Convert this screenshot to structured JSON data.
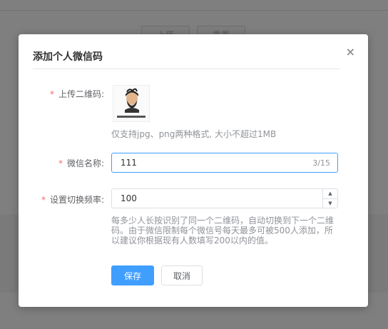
{
  "background": {
    "button_left_label": "上传",
    "button_right_label": "重置"
  },
  "dialog": {
    "title": "添加个人微信码",
    "close_icon": "×",
    "form": {
      "upload": {
        "label": "上传二维码:",
        "required_mark": "*",
        "thumbnail_icon": "avatar-qr-thumbnail",
        "hint": "仅支持jpg、png两种格式, 大小不超过1MB"
      },
      "name": {
        "label": "微信名称:",
        "required_mark": "*",
        "value": "111",
        "counter": "3/15"
      },
      "switch_frequency": {
        "label": "设置切换频率:",
        "required_mark": "*",
        "value": "100",
        "description": "每多少人长按识别了同一个二维码，自动切换到下一个二维码。由于微信限制每个微信号每天最多可被500人添加，所以建议你根据现有人数填写200以内的值。"
      }
    },
    "buttons": {
      "save": "保存",
      "cancel": "取消"
    }
  },
  "colors": {
    "primary": "#409eff",
    "required": "#f56c6c",
    "overlay": "#7f7f7f"
  }
}
